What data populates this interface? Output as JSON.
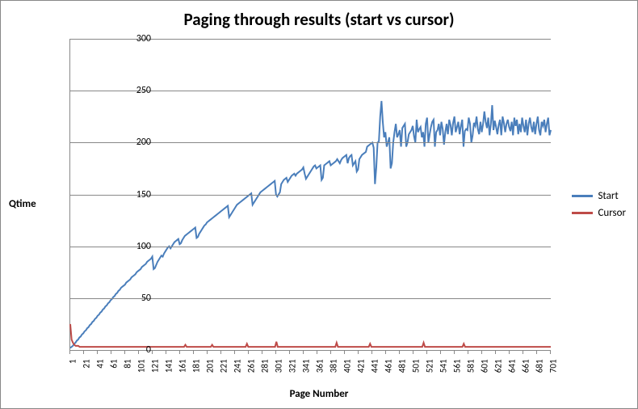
{
  "chart_data": {
    "type": "line",
    "title": "Paging through results (start vs cursor)",
    "xlabel": "Page Number",
    "ylabel": "Qtime",
    "ylim": [
      0,
      300
    ],
    "yticks": [
      0,
      50,
      100,
      150,
      200,
      250,
      300
    ],
    "x_start": 1,
    "x_end": 701,
    "x_tick_step": 20,
    "series": [
      {
        "name": "Start",
        "color": "#4a7ebb",
        "values": [
          2,
          3,
          4,
          6,
          7,
          9,
          10,
          12,
          13,
          15,
          16,
          18,
          19,
          21,
          22,
          24,
          25,
          27,
          28,
          30,
          31,
          33,
          34,
          36,
          37,
          39,
          40,
          42,
          43,
          45,
          46,
          48,
          49,
          51,
          52,
          54,
          55,
          57,
          58,
          60,
          61,
          62,
          63,
          65,
          66,
          67,
          68,
          70,
          71,
          72,
          73,
          75,
          76,
          77,
          78,
          80,
          81,
          82,
          83,
          85,
          86,
          87,
          88,
          90,
          78,
          79,
          82,
          85,
          87,
          89,
          91,
          90,
          93,
          95,
          97,
          99,
          100,
          98,
          100,
          102,
          104,
          105,
          106,
          107,
          102,
          103,
          106,
          108,
          110,
          111,
          112,
          113,
          114,
          115,
          116,
          117,
          118,
          108,
          109,
          112,
          114,
          116,
          118,
          120,
          121,
          123,
          124,
          125,
          126,
          127,
          128,
          129,
          130,
          131,
          132,
          133,
          134,
          135,
          136,
          137,
          138,
          139,
          128,
          130,
          132,
          134,
          136,
          138,
          140,
          141,
          142,
          143,
          144,
          145,
          146,
          147,
          148,
          149,
          150,
          151,
          140,
          142,
          144,
          146,
          148,
          150,
          152,
          153,
          154,
          155,
          156,
          157,
          158,
          159,
          160,
          161,
          162,
          163,
          150,
          148,
          150,
          152,
          160,
          162,
          164,
          165,
          166,
          162,
          164,
          166,
          168,
          169,
          170,
          168,
          170,
          171,
          172,
          173,
          174,
          176,
          170,
          165,
          167,
          169,
          171,
          173,
          175,
          177,
          178,
          175,
          176,
          177,
          178,
          164,
          166,
          178,
          179,
          180,
          181,
          182,
          178,
          179,
          180,
          181,
          182,
          184,
          182,
          180,
          183,
          185,
          186,
          187,
          188,
          180,
          185,
          187,
          188,
          178,
          180,
          182,
          172,
          174,
          184,
          186,
          188,
          189,
          190,
          191,
          196,
          197,
          198,
          199,
          200,
          195,
          160,
          176,
          200,
          201,
          225,
          240,
          220,
          205,
          210,
          196,
          200,
          205,
          175,
          180,
          200,
          210,
          218,
          205,
          208,
          212,
          196,
          214,
          216,
          218,
          196,
          200,
          208,
          210,
          212,
          216,
          206,
          200,
          222,
          210,
          213,
          215,
          205,
          210,
          196,
          218,
          224,
          200,
          208,
          215,
          220,
          222,
          196,
          210,
          212,
          218,
          207,
          220,
          213,
          198,
          210,
          218,
          208,
          222,
          217,
          207,
          219,
          225,
          210,
          215,
          220,
          208,
          216,
          222,
          196,
          211,
          213,
          212,
          224,
          218,
          200,
          207,
          219,
          216,
          225,
          213,
          208,
          220,
          210,
          218,
          230,
          220,
          214,
          224,
          207,
          218,
          236,
          212,
          221,
          215,
          208,
          217,
          222,
          207,
          225,
          219,
          210,
          218,
          222,
          215,
          211,
          220,
          207,
          224,
          216,
          222,
          208,
          218,
          210,
          224,
          216,
          210,
          222,
          207,
          218,
          224,
          215,
          210,
          220,
          208,
          218,
          225,
          212,
          207,
          220,
          216,
          222,
          210,
          218,
          224,
          207,
          212
        ]
      },
      {
        "name": "Cursor",
        "color": "#be4b48",
        "values": [
          25,
          10,
          7,
          5,
          4,
          4,
          4,
          3,
          3,
          3,
          3,
          3,
          3,
          3,
          3,
          3,
          3,
          3,
          3,
          3,
          3,
          3,
          3,
          3,
          3,
          3,
          3,
          3,
          3,
          3,
          3,
          3,
          3,
          3,
          3,
          3,
          3,
          3,
          3,
          3,
          3,
          3,
          3,
          3,
          3,
          3,
          3,
          3,
          3,
          3,
          3,
          3,
          3,
          3,
          3,
          3,
          3,
          3,
          3,
          3,
          3,
          3,
          3,
          3,
          3,
          3,
          3,
          3,
          3,
          3,
          3,
          3,
          3,
          3,
          3,
          3,
          3,
          3,
          3,
          3,
          3,
          3,
          3,
          3,
          3,
          3,
          5,
          3,
          3,
          3,
          3,
          3,
          3,
          3,
          3,
          3,
          3,
          3,
          3,
          3,
          3,
          3,
          3,
          3,
          3,
          3,
          5,
          3,
          3,
          3,
          3,
          3,
          3,
          3,
          3,
          3,
          3,
          3,
          3,
          3,
          3,
          3,
          3,
          3,
          3,
          3,
          3,
          3,
          3,
          3,
          3,
          3,
          6,
          3,
          3,
          3,
          3,
          3,
          3,
          3,
          3,
          3,
          3,
          3,
          3,
          3,
          3,
          3,
          3,
          3,
          3,
          3,
          3,
          3,
          8,
          3,
          3,
          3,
          3,
          3,
          3,
          3,
          3,
          3,
          3,
          3,
          3,
          3,
          3,
          3,
          3,
          3,
          3,
          3,
          3,
          3,
          3,
          3,
          3,
          3,
          3,
          3,
          3,
          3,
          3,
          3,
          3,
          3,
          3,
          3,
          3,
          3,
          3,
          3,
          3,
          3,
          3,
          3,
          3,
          7,
          3,
          3,
          3,
          3,
          3,
          3,
          3,
          3,
          3,
          3,
          3,
          3,
          3,
          3,
          3,
          3,
          3,
          3,
          3,
          3,
          3,
          3,
          3,
          3,
          6,
          3,
          3,
          3,
          3,
          3,
          3,
          3,
          3,
          3,
          3,
          3,
          3,
          3,
          3,
          3,
          3,
          3,
          3,
          3,
          3,
          3,
          3,
          3,
          3,
          3,
          3,
          3,
          3,
          3,
          3,
          3,
          3,
          3,
          3,
          3,
          3,
          3,
          3,
          3,
          7,
          3,
          3,
          3,
          3,
          3,
          3,
          3,
          3,
          3,
          3,
          3,
          3,
          3,
          3,
          3,
          3,
          3,
          3,
          3,
          3,
          3,
          3,
          3,
          3,
          3,
          3,
          3,
          3,
          3,
          6,
          3,
          3,
          3,
          3,
          3,
          3,
          3,
          3,
          3,
          3,
          3,
          3,
          3,
          3,
          3,
          3,
          3,
          3,
          3,
          3,
          3,
          3,
          3,
          3,
          3,
          3,
          3,
          3,
          3,
          3,
          3,
          3,
          3,
          3,
          3,
          3,
          3,
          3,
          3,
          3,
          3,
          3,
          3,
          3,
          3,
          3,
          3,
          3,
          3,
          3,
          3,
          3,
          3,
          3,
          3,
          3,
          3,
          3,
          3,
          3,
          3,
          3,
          3,
          3,
          3
        ]
      }
    ],
    "legend_position": "right"
  }
}
